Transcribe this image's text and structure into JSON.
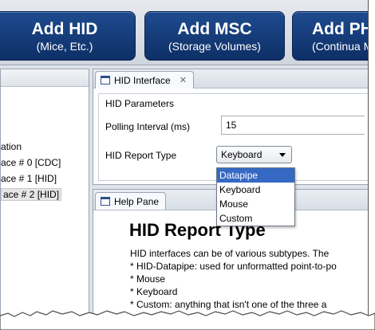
{
  "toolbar": {
    "buttons": [
      {
        "title": "Add HID",
        "subtitle": "(Mice, Etc.)"
      },
      {
        "title": "Add MSC",
        "subtitle": "(Storage Volumes)"
      },
      {
        "title": "Add PH",
        "subtitle": "(Continua M"
      }
    ]
  },
  "tree": {
    "items": [
      "ation",
      "ace # 0 [CDC]",
      "ace # 1 [HID]",
      "ace # 2 [HID]"
    ]
  },
  "hid_pane": {
    "tab_label": "HID Interface",
    "close_glyph": "✕",
    "group_title": "HID Parameters",
    "polling_label": "Polling Interval (ms)",
    "polling_value": "15",
    "report_type_label": "HID Report Type",
    "report_type_value": "Keyboard"
  },
  "dropdown": {
    "options": [
      "Datapipe",
      "Keyboard",
      "Mouse",
      "Custom"
    ],
    "highlighted": "Datapipe"
  },
  "help": {
    "tab_label": "Help Pane",
    "heading": "HID Report Type",
    "lines": [
      "HID interfaces can be of various subtypes.  The",
      "* HID-Datapipe: used for unformatted point-to-po",
      "* Mouse",
      "* Keyboard",
      "* Custom:  anything that isn't one of the three a"
    ]
  },
  "colors": {
    "button_blue": "#14397a",
    "selection_blue": "#3569c4"
  }
}
